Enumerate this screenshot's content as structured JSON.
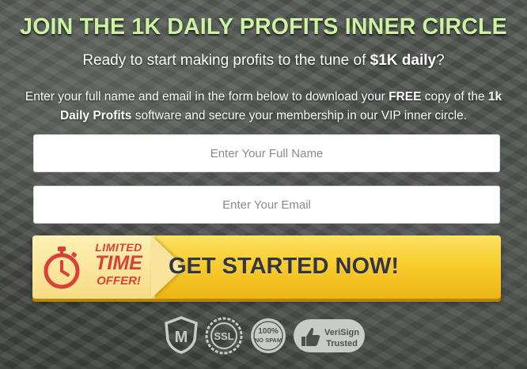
{
  "headline": "JOIN THE 1K DAILY PROFITS INNER CIRCLE",
  "subhead": {
    "before": "Ready to start making profits to the tune of ",
    "bold": "$1K daily",
    "after": "?"
  },
  "description": {
    "part1": "Enter your full name and email in the form below to download your ",
    "free": "FREE",
    "part2": " copy of the ",
    "product": "1k Daily Profits",
    "part3": " software and secure your membership in our VIP inner circle."
  },
  "form": {
    "name_placeholder": "Enter Your Full Name",
    "email_placeholder": "Enter Your Email",
    "name_value": "",
    "email_value": ""
  },
  "cta": {
    "badge_line1": "LIMITED",
    "badge_line2": "TIME",
    "badge_line3": "OFFER!",
    "label": "GET STARTED NOW!"
  },
  "trust_badges": {
    "mcafee": "M",
    "ssl": "SSL",
    "nospam_line1": "100%",
    "nospam_line2": "NO SPAM",
    "verisign_line1": "VeriSign",
    "verisign_line2": "Trusted"
  },
  "colors": {
    "headline": "#cdf3a2",
    "cta_yellow": "#f8cd2e",
    "badge_red": "#d9403a",
    "cta_text": "#333641"
  },
  "icons": {
    "timer": "stopwatch-icon",
    "security": "mcafee-shield-icon",
    "ssl": "ssl-seal-icon",
    "nospam": "no-spam-seal-icon",
    "verisign": "verisign-thumb-icon"
  }
}
